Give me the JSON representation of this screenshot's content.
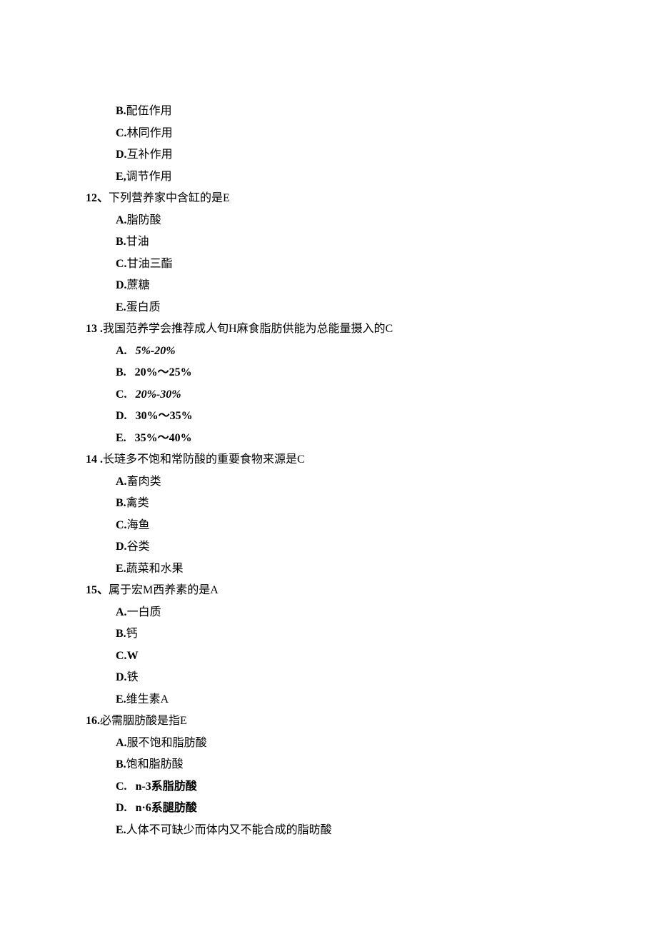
{
  "q11": {
    "optB": {
      "label": "B.",
      "text": "配伍作用"
    },
    "optC": {
      "label": "C.",
      "text": "林同作用"
    },
    "optD": {
      "label": "D.",
      "text": "互补作用"
    },
    "optE": {
      "label": "E,",
      "text": "调节作用"
    }
  },
  "q12": {
    "num": "12、",
    "stem": "下列营养家中含缸的是E",
    "optA": {
      "label": "A.",
      "text": "脂防酸"
    },
    "optB": {
      "label": "B.",
      "text": "甘油"
    },
    "optC": {
      "label": "C.",
      "text": "甘油三酯"
    },
    "optD": {
      "label": "D.",
      "text": "蔗糖"
    },
    "optE": {
      "label": "E.",
      "text": "蛋白质"
    }
  },
  "q13": {
    "num": "13  .",
    "stem": "我国范养学会推荐成人旬H麻食脂肪供能为总能量摄入的C",
    "optA": {
      "label": "A.",
      "text": "5%-20%"
    },
    "optB": {
      "label": "B.",
      "text": "20%～25%"
    },
    "optC": {
      "label": "C.",
      "text": "20%-30%"
    },
    "optD": {
      "label": "D.",
      "text": "30%～35%"
    },
    "optE": {
      "label": "E.",
      "text": "35%～40%"
    }
  },
  "q14": {
    "num": "14  .",
    "stem": "长琏多不饱和常防酸的重要食物来源是C",
    "optA": {
      "label": "A.",
      "text": "畜肉类"
    },
    "optB": {
      "label": "B.",
      "text": "禽类"
    },
    "optC": {
      "label": "C.",
      "text": "海鱼"
    },
    "optD": {
      "label": "D.",
      "text": "谷类"
    },
    "optE": {
      "label": "E.",
      "text": "蔬菜和水果"
    }
  },
  "q15": {
    "num": "15、",
    "stem": "属于宏M西养素的是A",
    "optA": {
      "label": "A.",
      "text": "一白质"
    },
    "optB": {
      "label": "B.",
      "text": "钙"
    },
    "optC": {
      "label": "C.",
      "text": "W"
    },
    "optD": {
      "label": "D.",
      "text": "铁"
    },
    "optE": {
      "label": "E.",
      "text": "维生素A"
    }
  },
  "q16": {
    "num": "16.",
    "stem": "必需胭肪酸是指E",
    "optA": {
      "label": "A.",
      "text": "服不饱和脂肪酸"
    },
    "optB": {
      "label": "B.",
      "text": "饱和脂肪酸"
    },
    "optC": {
      "label": "C.",
      "text": "n-3系脂肪酸"
    },
    "optD": {
      "label": "D.",
      "text": "n·6系腿肪酸"
    },
    "optE": {
      "label": "E.",
      "text": "人体不可缺少而体内又不能合成的脂昉酸"
    }
  }
}
